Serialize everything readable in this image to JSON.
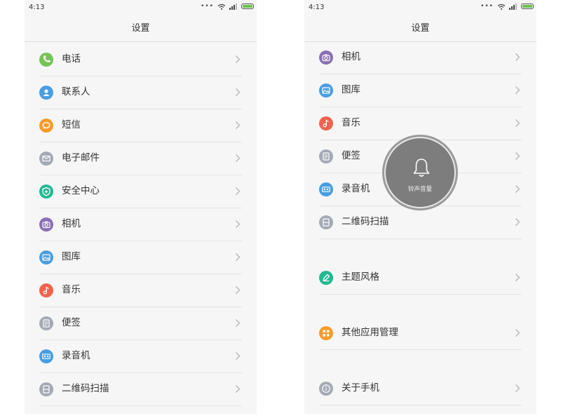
{
  "status_bar": {
    "time": "4:13",
    "more": "•••"
  },
  "header": {
    "title": "设置"
  },
  "left_list": [
    {
      "label": "电话",
      "icon": "phone-icon",
      "color": "#78c25a"
    },
    {
      "label": "联系人",
      "icon": "contacts-icon",
      "color": "#4a9de1"
    },
    {
      "label": "短信",
      "icon": "message-icon",
      "color": "#f59c2b"
    },
    {
      "label": "电子邮件",
      "icon": "email-icon",
      "color": "#a3aab4"
    },
    {
      "label": "安全中心",
      "icon": "shield-icon",
      "color": "#22b892"
    },
    {
      "label": "相机",
      "icon": "camera-icon",
      "color": "#8a6fb2"
    },
    {
      "label": "图库",
      "icon": "gallery-icon",
      "color": "#4a9de1"
    },
    {
      "label": "音乐",
      "icon": "music-icon",
      "color": "#f0624e"
    },
    {
      "label": "便签",
      "icon": "notes-icon",
      "color": "#a3aab4"
    },
    {
      "label": "录音机",
      "icon": "recorder-icon",
      "color": "#4a9de1"
    },
    {
      "label": "二维码扫描",
      "icon": "qr-scan-icon",
      "color": "#a3aab4"
    }
  ],
  "right_list": [
    {
      "label": "相机",
      "icon": "camera-icon",
      "color": "#8a6fb2"
    },
    {
      "label": "图库",
      "icon": "gallery-icon",
      "color": "#4a9de1"
    },
    {
      "label": "音乐",
      "icon": "music-icon",
      "color": "#f0624e"
    },
    {
      "label": "便签",
      "icon": "notes-icon",
      "color": "#a3aab4"
    },
    {
      "label": "录音机",
      "icon": "recorder-icon",
      "color": "#4a9de1"
    },
    {
      "label": "二维码扫描",
      "icon": "qr-scan-icon",
      "color": "#a3aab4"
    },
    {
      "label": "主题风格",
      "icon": "theme-icon",
      "color": "#22b892"
    },
    {
      "label": "其他应用管理",
      "icon": "apps-icon",
      "color": "#f59c2b"
    },
    {
      "label": "关于手机",
      "icon": "info-icon",
      "color": "#a3aab4"
    }
  ],
  "volume_overlay": {
    "label": "铃声音量",
    "icon": "bell-icon"
  }
}
